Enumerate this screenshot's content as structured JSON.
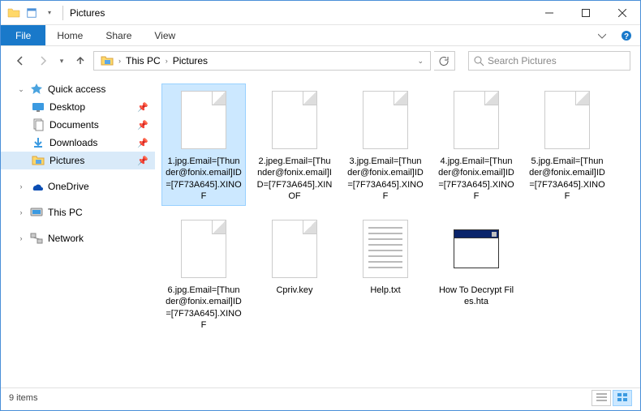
{
  "window": {
    "title": "Pictures"
  },
  "ribbon": {
    "file": "File",
    "home": "Home",
    "share": "Share",
    "view": "View"
  },
  "breadcrumb": {
    "root": "This PC",
    "current": "Pictures"
  },
  "search": {
    "placeholder": "Search Pictures"
  },
  "sidebar": {
    "quick_access": "Quick access",
    "desktop": "Desktop",
    "documents": "Documents",
    "downloads": "Downloads",
    "pictures": "Pictures",
    "onedrive": "OneDrive",
    "this_pc": "This PC",
    "network": "Network"
  },
  "files": [
    {
      "name": "1.jpg.Email=[Thunder@fonix.email]ID=[7F73A645].XINOF",
      "type": "blank",
      "selected": true
    },
    {
      "name": "2.jpeg.Email=[Thunder@fonix.email]ID=[7F73A645].XINOF",
      "type": "blank",
      "selected": false
    },
    {
      "name": "3.jpg.Email=[Thunder@fonix.email]ID=[7F73A645].XINOF",
      "type": "blank",
      "selected": false
    },
    {
      "name": "4.jpg.Email=[Thunder@fonix.email]ID=[7F73A645].XINOF",
      "type": "blank",
      "selected": false
    },
    {
      "name": "5.jpg.Email=[Thunder@fonix.email]ID=[7F73A645].XINOF",
      "type": "blank",
      "selected": false
    },
    {
      "name": "6.jpg.Email=[Thunder@fonix.email]ID=[7F73A645].XINOF",
      "type": "blank",
      "selected": false
    },
    {
      "name": "Cpriv.key",
      "type": "blank",
      "selected": false
    },
    {
      "name": "Help.txt",
      "type": "text",
      "selected": false
    },
    {
      "name": "How To Decrypt Files.hta",
      "type": "hta",
      "selected": false
    }
  ],
  "status": {
    "count": "9 items"
  }
}
